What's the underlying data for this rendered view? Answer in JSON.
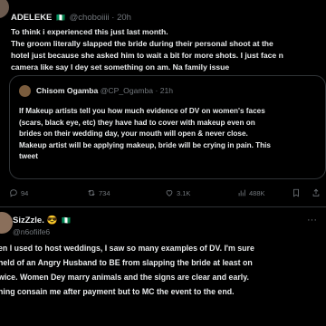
{
  "tweet1": {
    "name": "ADELEKE",
    "handle": "@choboiiii",
    "time": "· 20h",
    "lines": [
      "To think i experienced this just last month.",
      "The groom literally slapped the bride during their personal shoot at the",
      "hotel just because she asked him to wait a bit for more shots. I just face n",
      "camera like say I dey set something on am. Na family issue"
    ],
    "quote": {
      "name": "Chisom Ogamba",
      "handle": "@CP_Ogamba",
      "time": "· 21h",
      "lines": [
        "If Makeup artists tell you how much evidence of DV on women's faces",
        "(scars, black eye, etc) they have had to cover with makeup even on",
        "brides on their wedding day, your mouth will open & never close.",
        "Makeup artist will be applying makeup, bride will be crying in pain. This",
        "tweet"
      ]
    },
    "actions": {
      "replies": "94",
      "reposts": "734",
      "likes": "3.1K",
      "views": "488K"
    }
  },
  "tweet2": {
    "name": "SizZzle.",
    "emoji": "😎",
    "handle": "@n6ofiife6",
    "more": "···",
    "lines": [
      "en I used to host weddings, I saw so many examples of DV. I'm sure",
      "held of an Angry Husband to BE from slapping the bride at least on",
      "wice. Women Dey marry animals and the signs are clear and early.",
      "hing consain me after payment but to MC the event to the end."
    ]
  },
  "colors": {
    "background": "#000000",
    "text": "#e7e9ea",
    "muted": "#71767b",
    "border": "#2f3336"
  }
}
